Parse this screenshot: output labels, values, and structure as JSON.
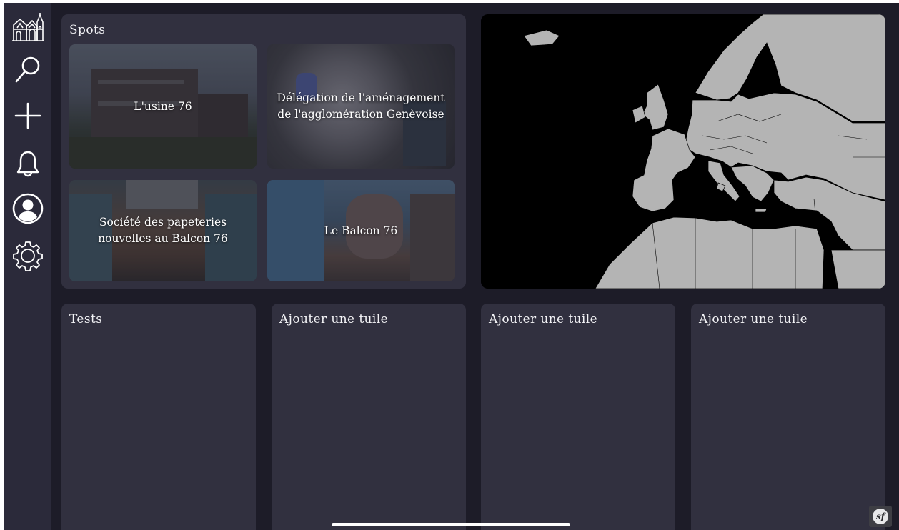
{
  "sidebar": {
    "items": [
      {
        "name": "home",
        "icon": "church-icon"
      },
      {
        "name": "search",
        "icon": "search-icon"
      },
      {
        "name": "add",
        "icon": "plus-icon"
      },
      {
        "name": "notifications",
        "icon": "bell-icon"
      },
      {
        "name": "profile",
        "icon": "user-icon"
      },
      {
        "name": "settings",
        "icon": "gear-icon"
      }
    ]
  },
  "spots": {
    "title": "Spots",
    "items": [
      {
        "label": "L'usine 76"
      },
      {
        "label": "Délégation de l'aménagement de l'agglomération Genèvoise"
      },
      {
        "label": "Société des papeteries nouvelles au Balcon 76"
      },
      {
        "label": "Le Balcon 76"
      }
    ]
  },
  "map": {
    "region": "Europe",
    "icon": "world-map"
  },
  "tiles": [
    {
      "title": "Tests"
    },
    {
      "title": "Ajouter une tuile"
    },
    {
      "title": "Ajouter une tuile"
    },
    {
      "title": "Ajouter une tuile"
    }
  ],
  "badge": {
    "text": "sf"
  },
  "colors": {
    "background": "#1d1c28",
    "sidebar": "#2b2a3a",
    "card": "#31303f",
    "text": "#f1f1f4",
    "land": "#b4b4b4"
  }
}
